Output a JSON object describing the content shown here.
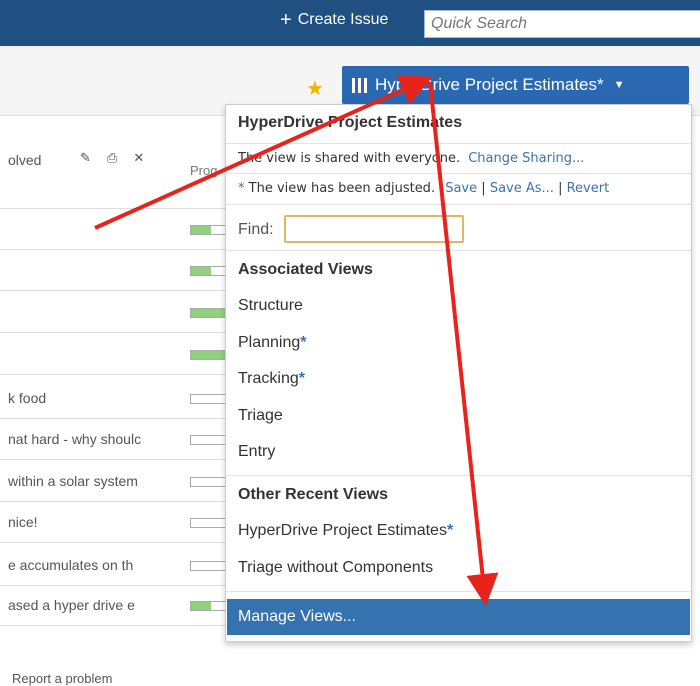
{
  "topbar": {
    "create_issue": "Create Issue",
    "quick_search_placeholder": "Quick Search"
  },
  "view_button": {
    "label": "HyperDrive Project Estimates*"
  },
  "table": {
    "resolved_text": "olved",
    "progress_header": "Prog",
    "rows": [
      {
        "text": "",
        "progress": 0.6
      },
      {
        "text": "",
        "progress": 0.6
      },
      {
        "text": "",
        "progress": 1.0
      },
      {
        "text": "",
        "progress": 1.0
      },
      {
        "text": "k food",
        "progress": 0
      },
      {
        "text": "nat hard - why shoulc",
        "progress": 0
      },
      {
        "text": "within a solar system",
        "progress": 0
      },
      {
        "text": "nice!",
        "progress": 0
      },
      {
        "text": "e accumulates on th",
        "progress": 0
      },
      {
        "text": "ased a hyper drive e",
        "progress": 0.6
      }
    ]
  },
  "dropdown": {
    "title": "HyperDrive Project Estimates",
    "shared_text": "The view is shared with everyone.",
    "change_sharing": "Change Sharing...",
    "adjusted_star": "*",
    "adjusted_text": "The view has been adjusted.",
    "save": "Save",
    "save_as": "Save As...",
    "revert": "Revert",
    "find_label": "Find:",
    "associated_views_header": "Associated Views",
    "associated_views": [
      {
        "label": "Structure",
        "modified": ""
      },
      {
        "label": "Planning",
        "modified": "*"
      },
      {
        "label": "Tracking",
        "modified": "*"
      },
      {
        "label": "Triage",
        "modified": ""
      },
      {
        "label": "Entry",
        "modified": ""
      }
    ],
    "other_recent_header": "Other Recent Views",
    "other_recent": [
      {
        "label": "HyperDrive Project Estimates",
        "modified": "*"
      },
      {
        "label": "Triage without Components",
        "modified": ""
      }
    ],
    "manage_views": "Manage Views..."
  },
  "footer": {
    "report": "Report a problem"
  },
  "colors": {
    "topbar": "#205081",
    "view_button": "#2a69b2",
    "manage_views": "#3572b0",
    "link": "#3b73af",
    "arrow": "#e8231c"
  },
  "icons": [
    "plus-icon",
    "star-icon",
    "columns-icon",
    "caret-down-icon",
    "edit-icon",
    "print-icon",
    "excel-icon"
  ]
}
